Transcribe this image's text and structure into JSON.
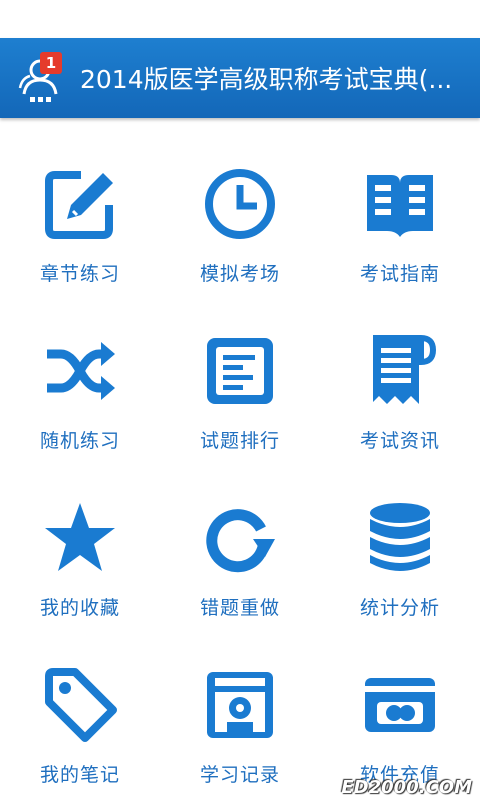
{
  "header": {
    "title": "2014版医学高级职称考试宝典(...",
    "badge": "1",
    "app_icon": "user-group-icon"
  },
  "menu": [
    {
      "label": "章节练习",
      "icon": "edit-icon"
    },
    {
      "label": "模拟考场",
      "icon": "clock-icon"
    },
    {
      "label": "考试指南",
      "icon": "book-icon"
    },
    {
      "label": "随机练习",
      "icon": "shuffle-icon"
    },
    {
      "label": "试题排行",
      "icon": "document-icon"
    },
    {
      "label": "考试资讯",
      "icon": "receipt-icon"
    },
    {
      "label": "我的收藏",
      "icon": "star-icon"
    },
    {
      "label": "错题重做",
      "icon": "redo-icon"
    },
    {
      "label": "统计分析",
      "icon": "database-icon"
    },
    {
      "label": "我的笔记",
      "icon": "tag-icon"
    },
    {
      "label": "学习记录",
      "icon": "disk-icon"
    },
    {
      "label": "软件充值",
      "icon": "card-icon"
    }
  ],
  "watermark": "ED2000.COM",
  "colors": {
    "accent": "#1a7bd1",
    "title_bar": "#1367b8",
    "badge": "#e53b2c"
  }
}
